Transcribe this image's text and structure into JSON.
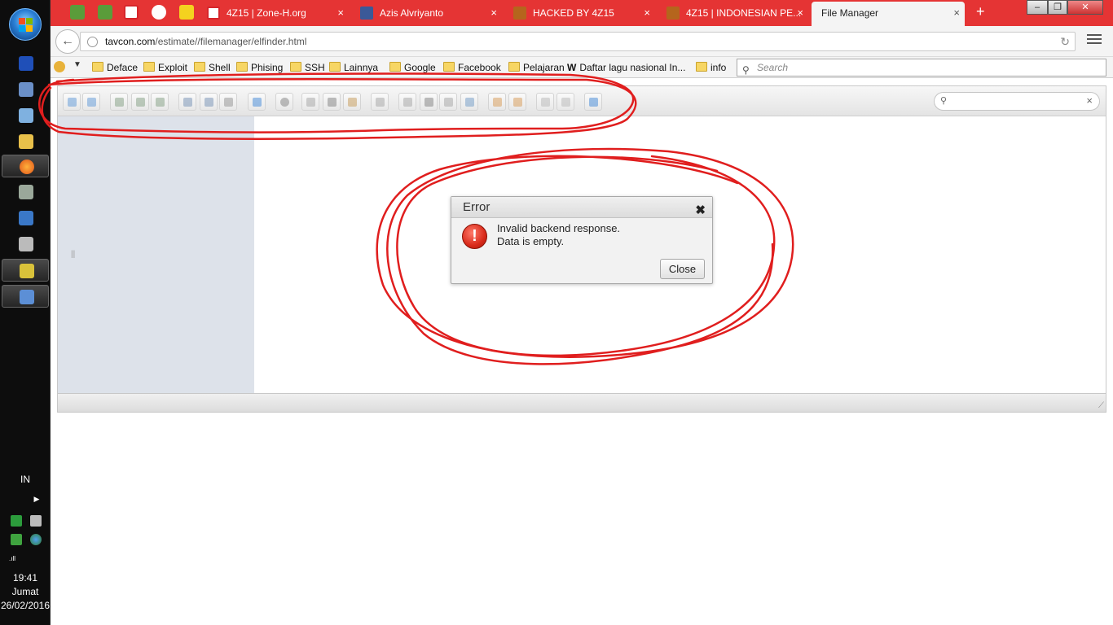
{
  "taskbar": {
    "clock_time": "19:41",
    "clock_day": "Jumat",
    "clock_date": "26/02/2016",
    "language": "IN"
  },
  "browser": {
    "tabs": [
      {
        "label": "4Z15 | Zone-H.org",
        "icon": "zone-h-icon",
        "color": "#d6262b"
      },
      {
        "label": "Azis Alvriyanto",
        "icon": "facebook-icon",
        "color": "#3b5998"
      },
      {
        "label": "HACKED BY 4Z15",
        "icon": "garuda-icon",
        "color": "#b5651d"
      },
      {
        "label": "4Z15 | INDONESIAN PE...",
        "icon": "garuda-icon",
        "color": "#b5651d"
      },
      {
        "label": "File Manager",
        "icon": "none",
        "color": "#f4f4f4"
      }
    ],
    "url_domain": "tavcon.com",
    "url_path": "/estimate//filemanager/elfinder.html",
    "bookmarks": [
      "Deface",
      "Exploit",
      "Shell",
      "Phising",
      "SSH",
      "Lainnya",
      "Google",
      "Facebook",
      "Pelajaran",
      "Daftar lagu nasional In...",
      "info"
    ],
    "bookmark_w_prefix": "W",
    "search_placeholder": "Search",
    "accent_color": "#e53434"
  },
  "elfinder": {
    "toolbar_icons": [
      "back-icon",
      "forward-icon",
      "home-icon",
      "up-icon",
      "reload-icon",
      "mkdir-icon",
      "mkfile-icon",
      "upload-icon",
      "open-icon",
      "download-icon",
      "getfile-icon",
      "info-icon",
      "quicklook-icon",
      "copy-icon",
      "cut-icon",
      "paste-icon",
      "rm-icon",
      "duplicate-icon",
      "rename-icon",
      "edit-icon",
      "resize-icon",
      "extract-icon",
      "archive-icon",
      "view-icon",
      "sort-icon",
      "help-icon"
    ],
    "search_placeholder": ""
  },
  "dialog": {
    "title": "Error",
    "line1": "Invalid backend response.",
    "line2": "Data is empty.",
    "close_label": "Close",
    "close_glyph": "✖",
    "icon_glyph": "!"
  }
}
